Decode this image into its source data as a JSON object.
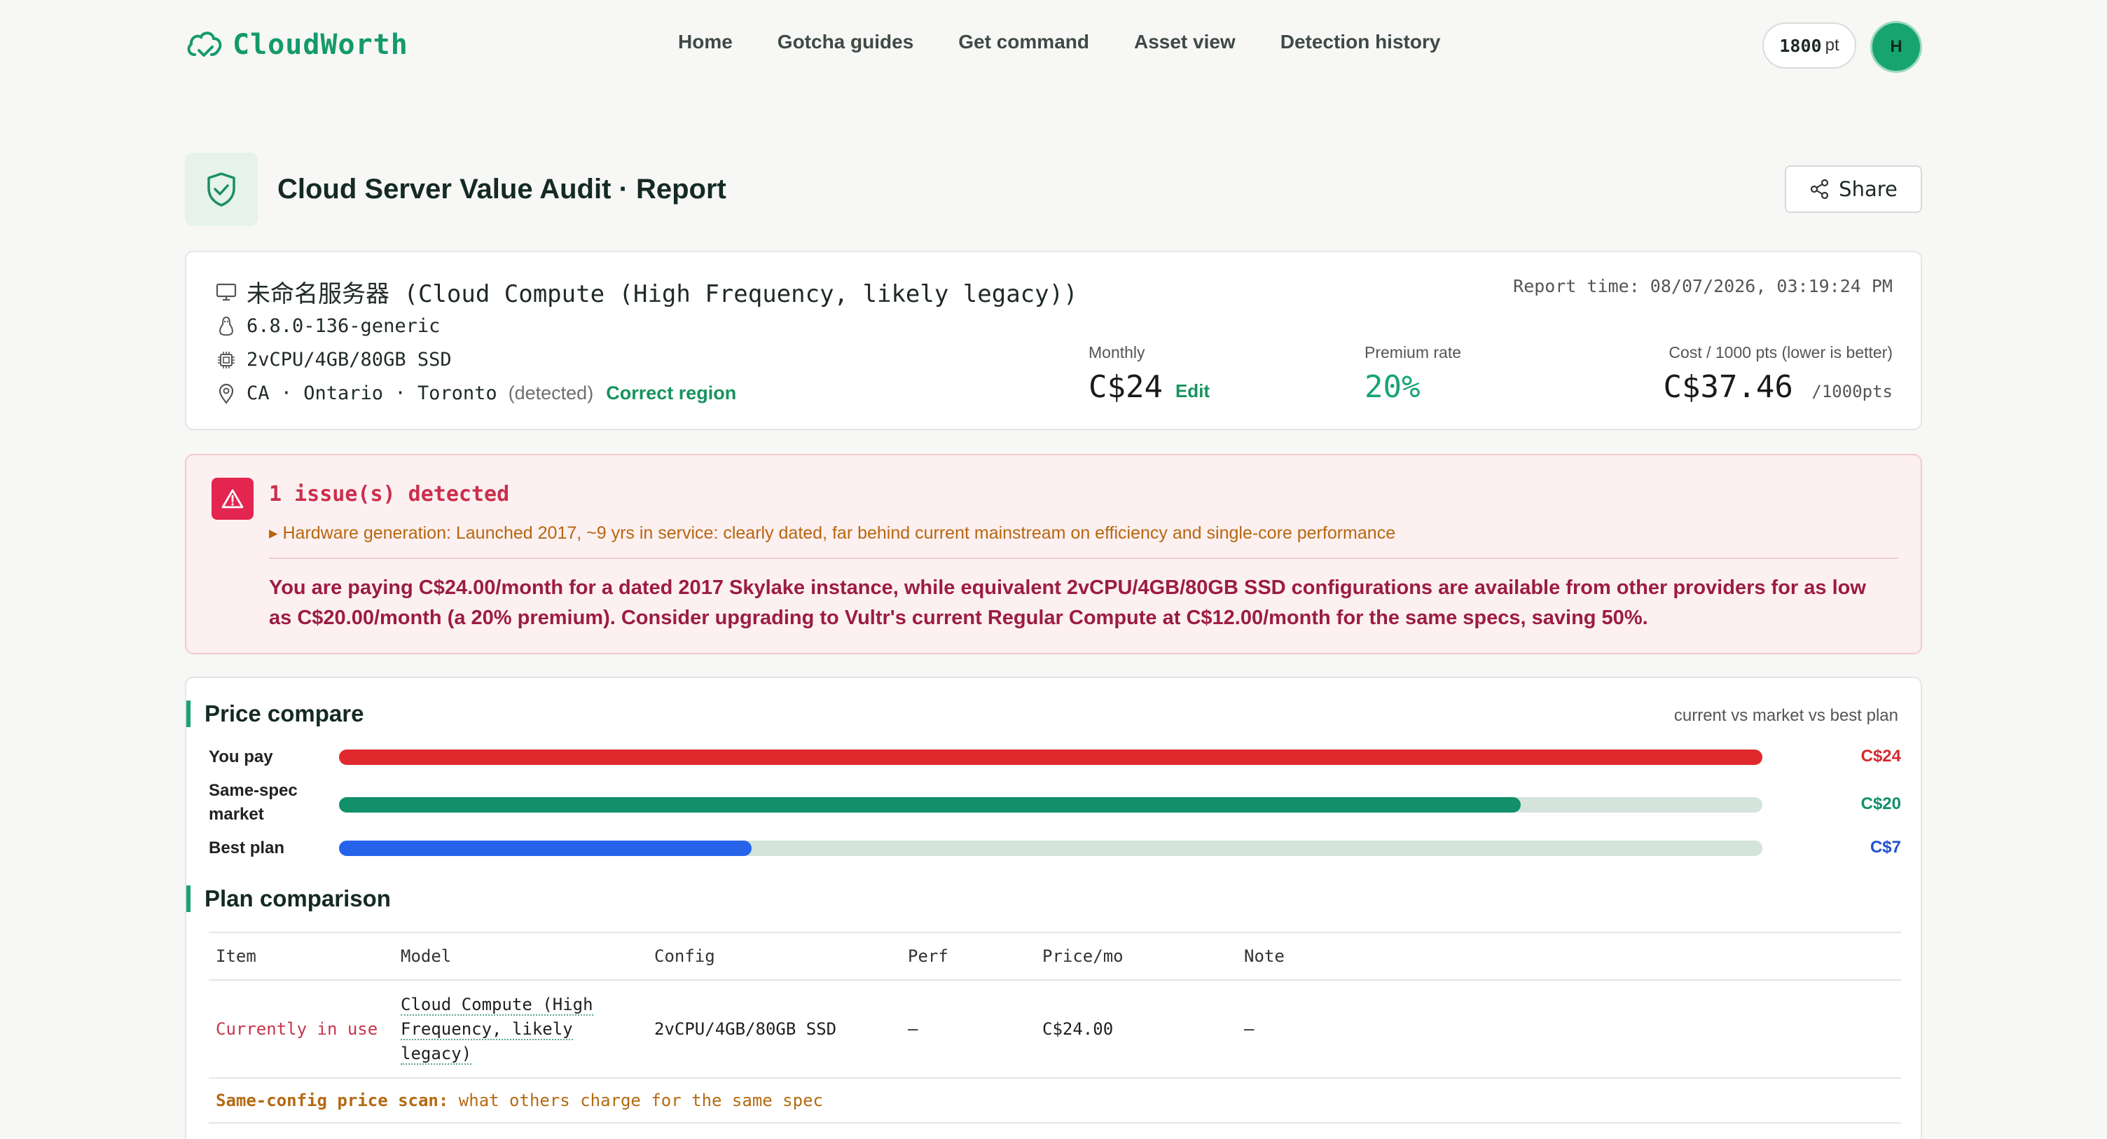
{
  "brand": {
    "name": "CloudWorth"
  },
  "nav": [
    {
      "label": "Home"
    },
    {
      "label": "Gotcha guides"
    },
    {
      "label": "Get command"
    },
    {
      "label": "Asset view"
    },
    {
      "label": "Detection history"
    }
  ],
  "account": {
    "points": "1800",
    "points_unit": "pt",
    "avatar_initial": "H"
  },
  "page": {
    "title": "Cloud Server Value Audit · Report",
    "share_label": "Share"
  },
  "server": {
    "name": "未命名服务器 (Cloud Compute (High Frequency, likely legacy))",
    "kernel": "6.8.0-136-generic",
    "specs": "2vCPU/4GB/80GB SSD",
    "region": "CA · Ontario · Toronto",
    "region_note": "(detected)",
    "correct_region_label": "Correct region",
    "report_time": "Report time: 08/07/2026, 03:19:24 PM"
  },
  "metrics": {
    "monthly_label": "Monthly",
    "monthly_value": "C$24",
    "edit_label": "Edit",
    "premium_label": "Premium rate",
    "premium_value": "20%",
    "cost_label": "Cost / 1000 pts (lower is better)",
    "cost_value": "C$37.46",
    "cost_unit": "/1000pts"
  },
  "alert": {
    "title": "1 issue(s) detected",
    "detail": "▸ Hardware generation: Launched 2017, ~9 yrs in service: clearly dated, far behind current mainstream on efficiency and single-core performance",
    "summary": "You are paying C$24.00/month for a dated 2017 Skylake instance, while equivalent 2vCPU/4GB/80GB SSD configurations are available from other providers for as low as C$20.00/month (a 20% premium). Consider upgrading to Vultr's current Regular Compute at C$12.00/month for the same specs, saving 50%."
  },
  "price_compare": {
    "title": "Price compare",
    "note": "current vs market vs best plan",
    "rows": [
      {
        "label": "You pay",
        "value_label": "C$24",
        "fraction": 1.0,
        "color": "#e0292d"
      },
      {
        "label": "Same-spec market",
        "value_label": "C$20",
        "fraction": 0.83,
        "color": "#11906a"
      },
      {
        "label": "Best plan",
        "value_label": "C$7",
        "fraction": 0.29,
        "color": "#2563eb"
      }
    ]
  },
  "plan_comparison": {
    "title": "Plan comparison",
    "columns": [
      "Item",
      "Model",
      "Config",
      "Perf",
      "Price/mo",
      "Note"
    ],
    "current_row": {
      "item": "Currently in use",
      "model": "Cloud Compute (High Frequency, likely legacy)",
      "config": "2vCPU/4GB/80GB SSD",
      "perf": "—",
      "price": "C$24.00",
      "note": "—"
    },
    "scan_label": "Same-config price scan:",
    "scan_text": "what others charge for the same spec"
  }
}
